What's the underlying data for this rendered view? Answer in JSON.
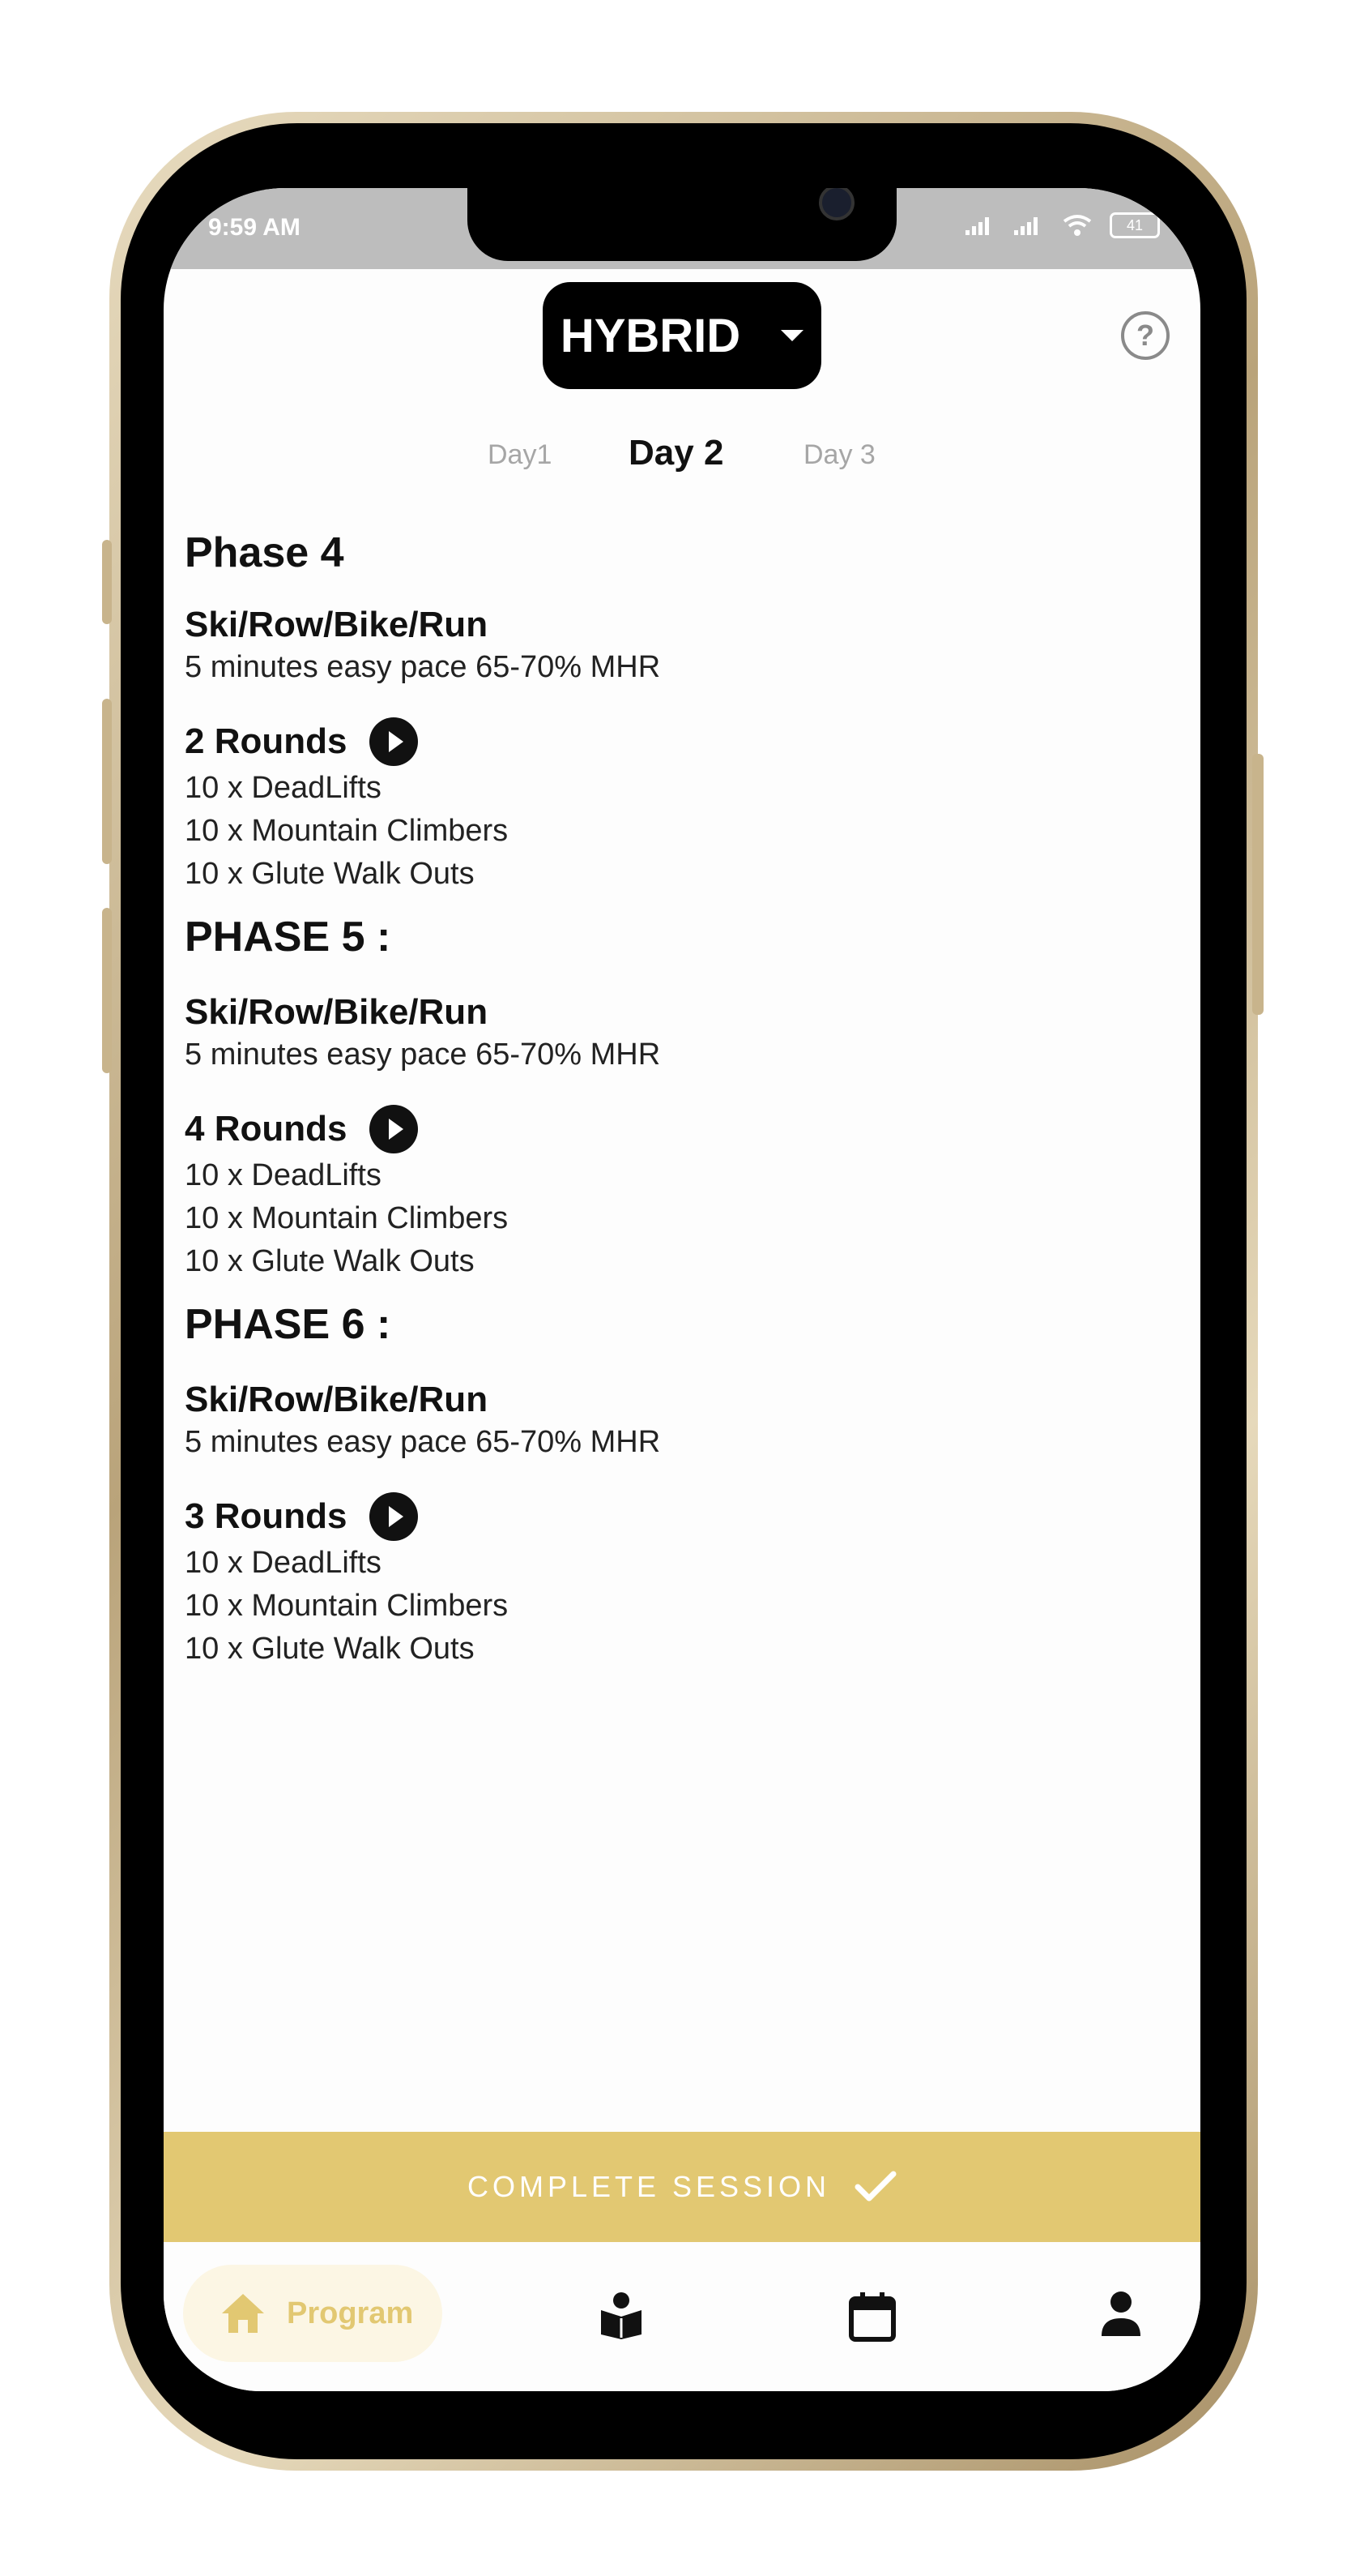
{
  "status": {
    "time": "9:59 AM",
    "battery": "41"
  },
  "header": {
    "program": "HYBRID",
    "help": "?"
  },
  "days": [
    "Day1",
    "Day 2",
    "Day 3"
  ],
  "active_day": "Day 2",
  "content": {
    "phase4": {
      "title": "Phase 4",
      "warmup_title": "Ski/Row/Bike/Run",
      "warmup_desc": "5 minutes easy pace 65-70% MHR",
      "rounds": "2 Rounds",
      "ex1": "10 x DeadLifts",
      "ex2": "10 x Mountain Climbers",
      "ex3": "10 x Glute Walk Outs"
    },
    "phase5": {
      "title": "PHASE 5 :",
      "warmup_title": "Ski/Row/Bike/Run",
      "warmup_desc": "5 minutes easy pace 65-70% MHR",
      "rounds": "4 Rounds",
      "ex1": "10 x DeadLifts",
      "ex2": "10 x Mountain Climbers",
      "ex3": "10 x Glute Walk Outs"
    },
    "phase6": {
      "title": "PHASE 6 :",
      "warmup_title": "Ski/Row/Bike/Run",
      "warmup_desc": "5 minutes easy pace 65-70% MHR",
      "rounds": "3 Rounds",
      "ex1": "10 x DeadLifts",
      "ex2": "10 x Mountain Climbers",
      "ex3": "10 x Glute Walk Outs"
    }
  },
  "complete_button": "COMPLETE SESSION",
  "nav": {
    "program_label": "Program",
    "icons": [
      "home-icon",
      "book-reader-icon",
      "calendar-icon",
      "person-icon"
    ]
  },
  "colors": {
    "accent": "#e2c872",
    "dark": "#000000"
  }
}
